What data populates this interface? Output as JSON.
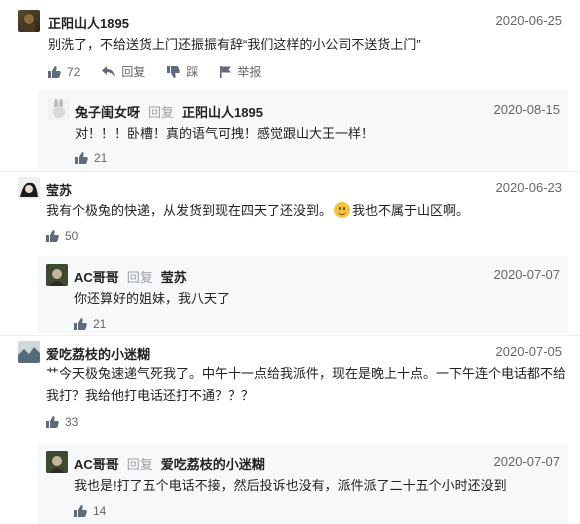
{
  "icons": [
    "like-icon",
    "reply-icon",
    "dislike-icon",
    "report-flag-icon",
    "emoji-smile-icon"
  ],
  "reply_label": "回复",
  "comments": [
    {
      "user": "正阳山人1895",
      "date": "2020-06-25",
      "text": "别洗了，不给送货上门还振振有辞“我们这样的小公司不送货上门”",
      "likes": "72",
      "reply": "回复",
      "dislike": "踩",
      "report": "举报"
    },
    {
      "user": "兔子闺女呀",
      "reply_to": "正阳山人1895",
      "date": "2020-08-15",
      "text": "对！！！卧槽！真的语气可拽！感觉跟山大王一样！",
      "likes": "21"
    },
    {
      "user": "莹苏",
      "date": "2020-06-23",
      "text_before": "我有个极兔的快递，从发货到现在四天了还没到。",
      "text_after": "我也不属于山区啊。",
      "likes": "50"
    },
    {
      "user": "AC哥哥",
      "reply_to": "莹苏",
      "date": "2020-07-07",
      "text": "你还算好的姐妹，我八天了",
      "likes": "21"
    },
    {
      "user": "爱吃荔枝的小迷糊",
      "date": "2020-07-05",
      "text_line1": "艹今天极兔速递气死我了。中午十一点给我派件，现在是晚上十点。一下午连个电话都不给",
      "text_line2": "我打？我给他打电话还打不通？？？",
      "likes": "33"
    },
    {
      "user": "AC哥哥",
      "reply_to": "爱吃荔枝的小迷糊",
      "date": "2020-07-07",
      "text": "我也是!打了五个电话不接，然后投诉也没有，派件派了二十五个小时还没到",
      "likes": "14"
    }
  ]
}
